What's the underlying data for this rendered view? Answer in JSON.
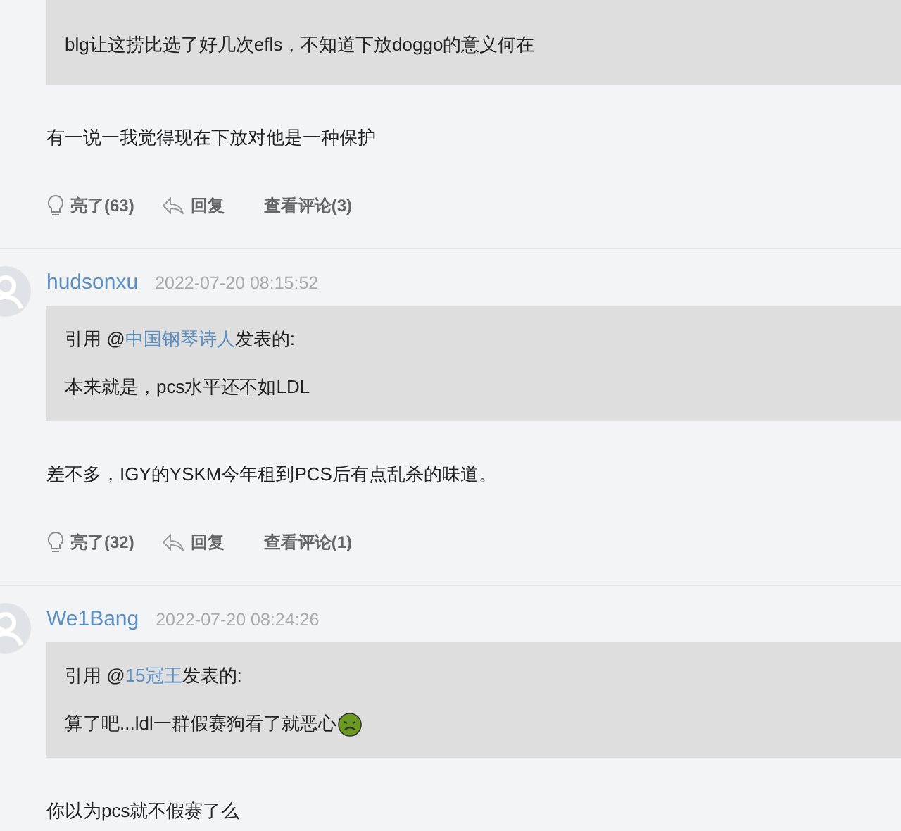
{
  "comments": [
    {
      "quote": {
        "body": "blg让这捞比选了好几次efls，不知道下放doggo的意义何在"
      },
      "text": "有一说一我觉得现在下放对他是一种保护",
      "actions": {
        "like": "亮了(63)",
        "reply": "回复",
        "view": "查看评论(3)"
      }
    },
    {
      "author": "hudsonxu",
      "time": "2022-07-20 08:15:52",
      "quote": {
        "prefix": "引用 @",
        "user": "中国钢琴诗人",
        "suffix": "发表的:",
        "body": "本来就是，pcs水平还不如LDL"
      },
      "text": "差不多，IGY的YSKM今年租到PCS后有点乱杀的味道。",
      "actions": {
        "like": "亮了(32)",
        "reply": "回复",
        "view": "查看评论(1)"
      }
    },
    {
      "author": "We1Bang",
      "time": "2022-07-20 08:24:26",
      "quote": {
        "prefix": "引用 @",
        "user": "15冠王",
        "suffix": "发表的:",
        "body": "算了吧...ldl一群假赛狗看了就恶心",
        "emoji": true
      },
      "text": "你以为pcs就不假赛了么"
    }
  ]
}
